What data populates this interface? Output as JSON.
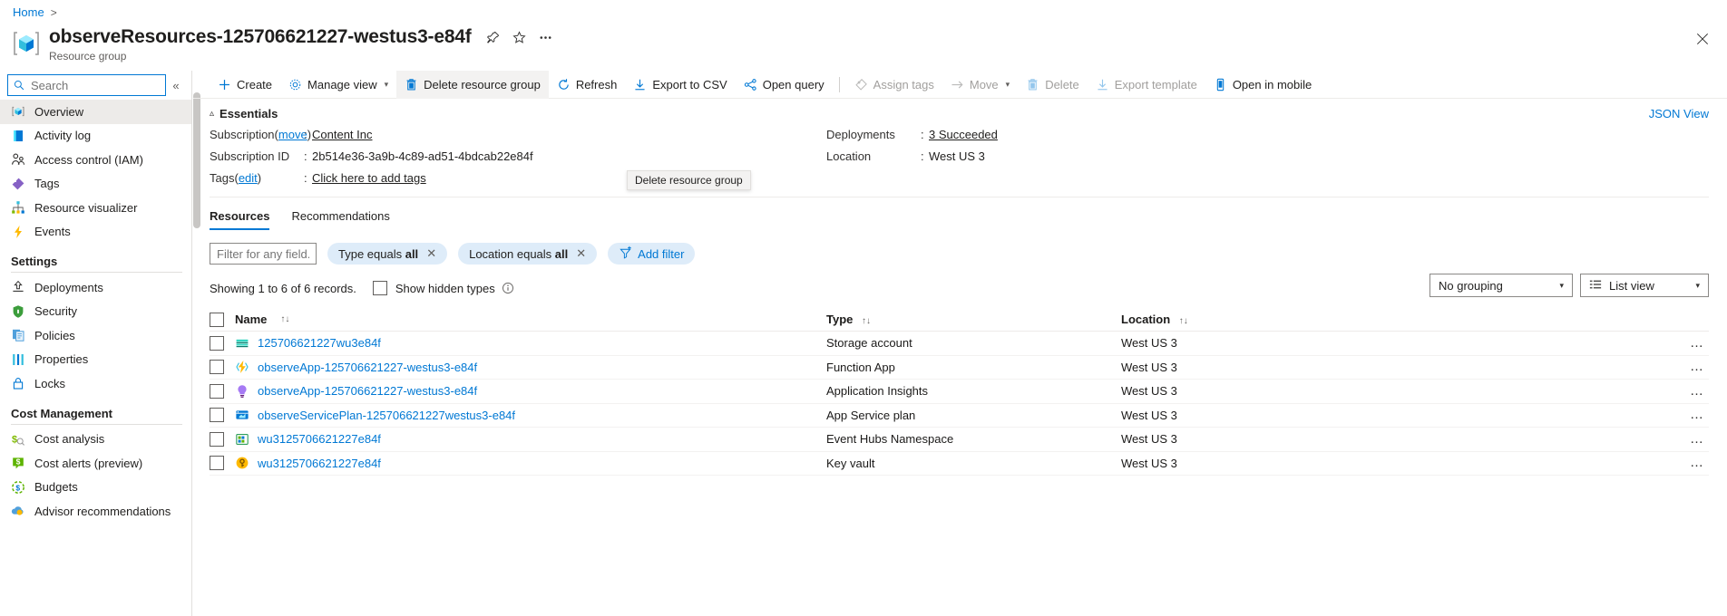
{
  "breadcrumb": {
    "items": [
      "Home"
    ],
    "separator": ">"
  },
  "header": {
    "title": "observeResources-125706621227-westus3-e84f",
    "subtitle": "Resource group",
    "icon": "resource-group-icon",
    "pin_icon": "pin-icon",
    "favorite_icon": "star-icon",
    "more_icon": "ellipsis-icon",
    "close_icon": "close-icon"
  },
  "sidebar": {
    "search": {
      "placeholder": "Search",
      "value": "",
      "icon": "search-icon"
    },
    "collapse_icon": "chevron-double-left-icon",
    "items": [
      {
        "label": "Overview",
        "icon": "overview-icon",
        "selected": true
      },
      {
        "label": "Activity log",
        "icon": "activity-log-icon",
        "selected": false
      },
      {
        "label": "Access control (IAM)",
        "icon": "access-control-icon",
        "selected": false
      },
      {
        "label": "Tags",
        "icon": "tags-icon",
        "selected": false
      },
      {
        "label": "Resource visualizer",
        "icon": "resource-visualizer-icon",
        "selected": false
      },
      {
        "label": "Events",
        "icon": "events-icon",
        "selected": false
      }
    ],
    "sections": [
      {
        "title": "Settings",
        "items": [
          {
            "label": "Deployments",
            "icon": "deployments-icon"
          },
          {
            "label": "Security",
            "icon": "security-icon"
          },
          {
            "label": "Policies",
            "icon": "policies-icon"
          },
          {
            "label": "Properties",
            "icon": "properties-icon"
          },
          {
            "label": "Locks",
            "icon": "locks-icon"
          }
        ]
      },
      {
        "title": "Cost Management",
        "items": [
          {
            "label": "Cost analysis",
            "icon": "cost-analysis-icon"
          },
          {
            "label": "Cost alerts (preview)",
            "icon": "cost-alerts-icon"
          },
          {
            "label": "Budgets",
            "icon": "budgets-icon"
          },
          {
            "label": "Advisor recommendations",
            "icon": "advisor-icon"
          }
        ]
      }
    ]
  },
  "toolbar": {
    "buttons": [
      {
        "label": "Create",
        "icon": "plus-icon",
        "disabled": false,
        "caret": false,
        "active": false
      },
      {
        "label": "Manage view",
        "icon": "gear-icon",
        "disabled": false,
        "caret": true,
        "active": false
      },
      {
        "label": "Delete resource group",
        "icon": "trash-icon",
        "disabled": false,
        "caret": false,
        "active": true
      },
      {
        "label": "Refresh",
        "icon": "refresh-icon",
        "disabled": false,
        "caret": false,
        "active": false
      },
      {
        "label": "Export to CSV",
        "icon": "download-icon",
        "disabled": false,
        "caret": false,
        "active": false
      },
      {
        "label": "Open query",
        "icon": "open-query-icon",
        "disabled": false,
        "caret": false,
        "active": false
      },
      {
        "separator": true
      },
      {
        "label": "Assign tags",
        "icon": "tag-icon",
        "disabled": true,
        "caret": false,
        "active": false
      },
      {
        "label": "Move",
        "icon": "arrow-right-icon",
        "disabled": true,
        "caret": true,
        "active": false
      },
      {
        "label": "Delete",
        "icon": "trash-icon",
        "disabled": true,
        "caret": false,
        "active": false
      },
      {
        "label": "Export template",
        "icon": "download-icon",
        "disabled": true,
        "caret": false,
        "active": false
      },
      {
        "label": "Open in mobile",
        "icon": "mobile-icon",
        "disabled": false,
        "caret": false,
        "active": false
      }
    ],
    "tooltip": "Delete resource group"
  },
  "essentials": {
    "heading": "Essentials",
    "collapse_icon": "chevron-up-icon",
    "json_view": "JSON View",
    "left": [
      {
        "label": "Subscription",
        "label_link": "move",
        "label_suffix": ")",
        "label_prefix": " (",
        "sep": ":",
        "value": "Content Inc",
        "is_link": true
      },
      {
        "label": "Subscription ID",
        "sep": ":",
        "value": "2b514e36-3a9b-4c89-ad51-4bdcab22e84f",
        "is_link": false
      },
      {
        "label": "Tags",
        "label_link": "edit",
        "label_suffix": ")",
        "label_prefix": " (",
        "sep": ":",
        "value": "Click here to add tags",
        "is_link": true
      }
    ],
    "right": [
      {
        "label": "Deployments",
        "sep": ":",
        "value": "3 Succeeded",
        "is_link": true
      },
      {
        "label": "Location",
        "sep": ":",
        "value": "West US 3",
        "is_link": false
      }
    ]
  },
  "tabs": [
    {
      "label": "Resources",
      "active": true
    },
    {
      "label": "Recommendations",
      "active": false
    }
  ],
  "filters": {
    "input_placeholder": "Filter for any field...",
    "input_value": "",
    "pills": [
      {
        "text": "Type equals ",
        "bold": "all",
        "close_icon": "close-icon"
      },
      {
        "text": "Location equals ",
        "bold": "all",
        "close_icon": "close-icon"
      }
    ],
    "add_filter": {
      "label": "Add filter",
      "icon": "add-filter-icon"
    }
  },
  "records": {
    "text": "Showing 1 to 6 of 6 records.",
    "show_hidden_label": "Show hidden types",
    "show_hidden_checked": false,
    "info_icon": "info-icon",
    "grouping": {
      "value": "No grouping",
      "caret_icon": "chevron-down-icon"
    },
    "view": {
      "value": "List view",
      "icon": "list-view-icon",
      "caret_icon": "chevron-down-icon"
    }
  },
  "table": {
    "columns": [
      {
        "label": "Name",
        "sort_icon": "sort-icon"
      },
      {
        "label": "Type",
        "sort_icon": "sort-icon"
      },
      {
        "label": "Location",
        "sort_icon": "sort-icon"
      }
    ],
    "rows": [
      {
        "name": "125706621227wu3e84f",
        "type": "Storage account",
        "location": "West US 3",
        "icon": "storage-account-icon",
        "menu_icon": "ellipsis-icon"
      },
      {
        "name": "observeApp-125706621227-westus3-e84f",
        "type": "Function App",
        "location": "West US 3",
        "icon": "function-app-icon",
        "menu_icon": "ellipsis-icon"
      },
      {
        "name": "observeApp-125706621227-westus3-e84f",
        "type": "Application Insights",
        "location": "West US 3",
        "icon": "app-insights-icon",
        "menu_icon": "ellipsis-icon"
      },
      {
        "name": "observeServicePlan-125706621227westus3-e84f",
        "type": "App Service plan",
        "location": "West US 3",
        "icon": "app-service-plan-icon",
        "menu_icon": "ellipsis-icon"
      },
      {
        "name": "wu3125706621227e84f",
        "type": "Event Hubs Namespace",
        "location": "West US 3",
        "icon": "event-hubs-icon",
        "menu_icon": "ellipsis-icon"
      },
      {
        "name": "wu3125706621227e84f",
        "type": "Key vault",
        "location": "West US 3",
        "icon": "key-vault-icon",
        "menu_icon": "ellipsis-icon"
      }
    ]
  },
  "colors": {
    "accent": "#0078d4",
    "pill_bg": "#deecf9",
    "selected_nav": "#edebe9",
    "border": "#e1dfdd"
  }
}
